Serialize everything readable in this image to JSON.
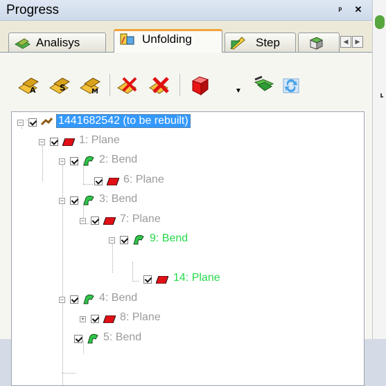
{
  "window": {
    "title": "Progress",
    "pin_icon": "pin-icon",
    "close_icon": "close-icon"
  },
  "tabs": [
    {
      "label": "Analisys",
      "icon": "analysis-icon"
    },
    {
      "label": "Unfolding",
      "icon": "unfolding-icon",
      "active": true
    },
    {
      "label": "Step",
      "icon": "step-icon"
    },
    {
      "label": "",
      "icon": "more-tab-icon"
    }
  ],
  "toolbar": {
    "tools": [
      {
        "name": "unfold-a-tool",
        "icon": "unfold-a-icon"
      },
      {
        "name": "unfold-s-tool",
        "icon": "unfold-s-icon"
      },
      {
        "name": "unfold-m-tool",
        "icon": "unfold-m-icon"
      },
      {
        "name": "delete-unfold-tool",
        "icon": "delete-unfold-icon"
      },
      {
        "name": "delete-all-tool",
        "icon": "delete-all-icon"
      },
      {
        "name": "cube-tool",
        "icon": "cube-icon"
      },
      {
        "name": "apply-tool",
        "icon": "apply-icon"
      },
      {
        "name": "refresh-tool",
        "icon": "refresh-icon"
      }
    ]
  },
  "tree": {
    "root_label": "1441682542 (to be rebuilt)",
    "nodes": [
      {
        "label": "1: Plane",
        "type": "plane",
        "level": 1
      },
      {
        "label": "2: Bend",
        "type": "bend",
        "level": 2
      },
      {
        "label": "6: Plane",
        "type": "plane",
        "level": 3
      },
      {
        "label": "3: Bend",
        "type": "bend",
        "level": 2
      },
      {
        "label": "7: Plane",
        "type": "plane",
        "level": 3
      },
      {
        "label": "9: Bend",
        "type": "bend",
        "level": 4,
        "highlight": true
      },
      {
        "label": "14: Plane",
        "type": "plane",
        "level": 5,
        "highlight": true
      },
      {
        "label": "4: Bend",
        "type": "bend",
        "level": 2
      },
      {
        "label": "8: Plane",
        "type": "plane",
        "level": 3
      },
      {
        "label": "5: Bend",
        "type": "bend",
        "level": 2
      }
    ]
  },
  "colors": {
    "accent_orange": "#f2a33a",
    "selection_blue": "#3399ff",
    "highlight_green": "#25d94a",
    "plane_red": "#e10f16",
    "bend_green": "#2fc64b"
  }
}
